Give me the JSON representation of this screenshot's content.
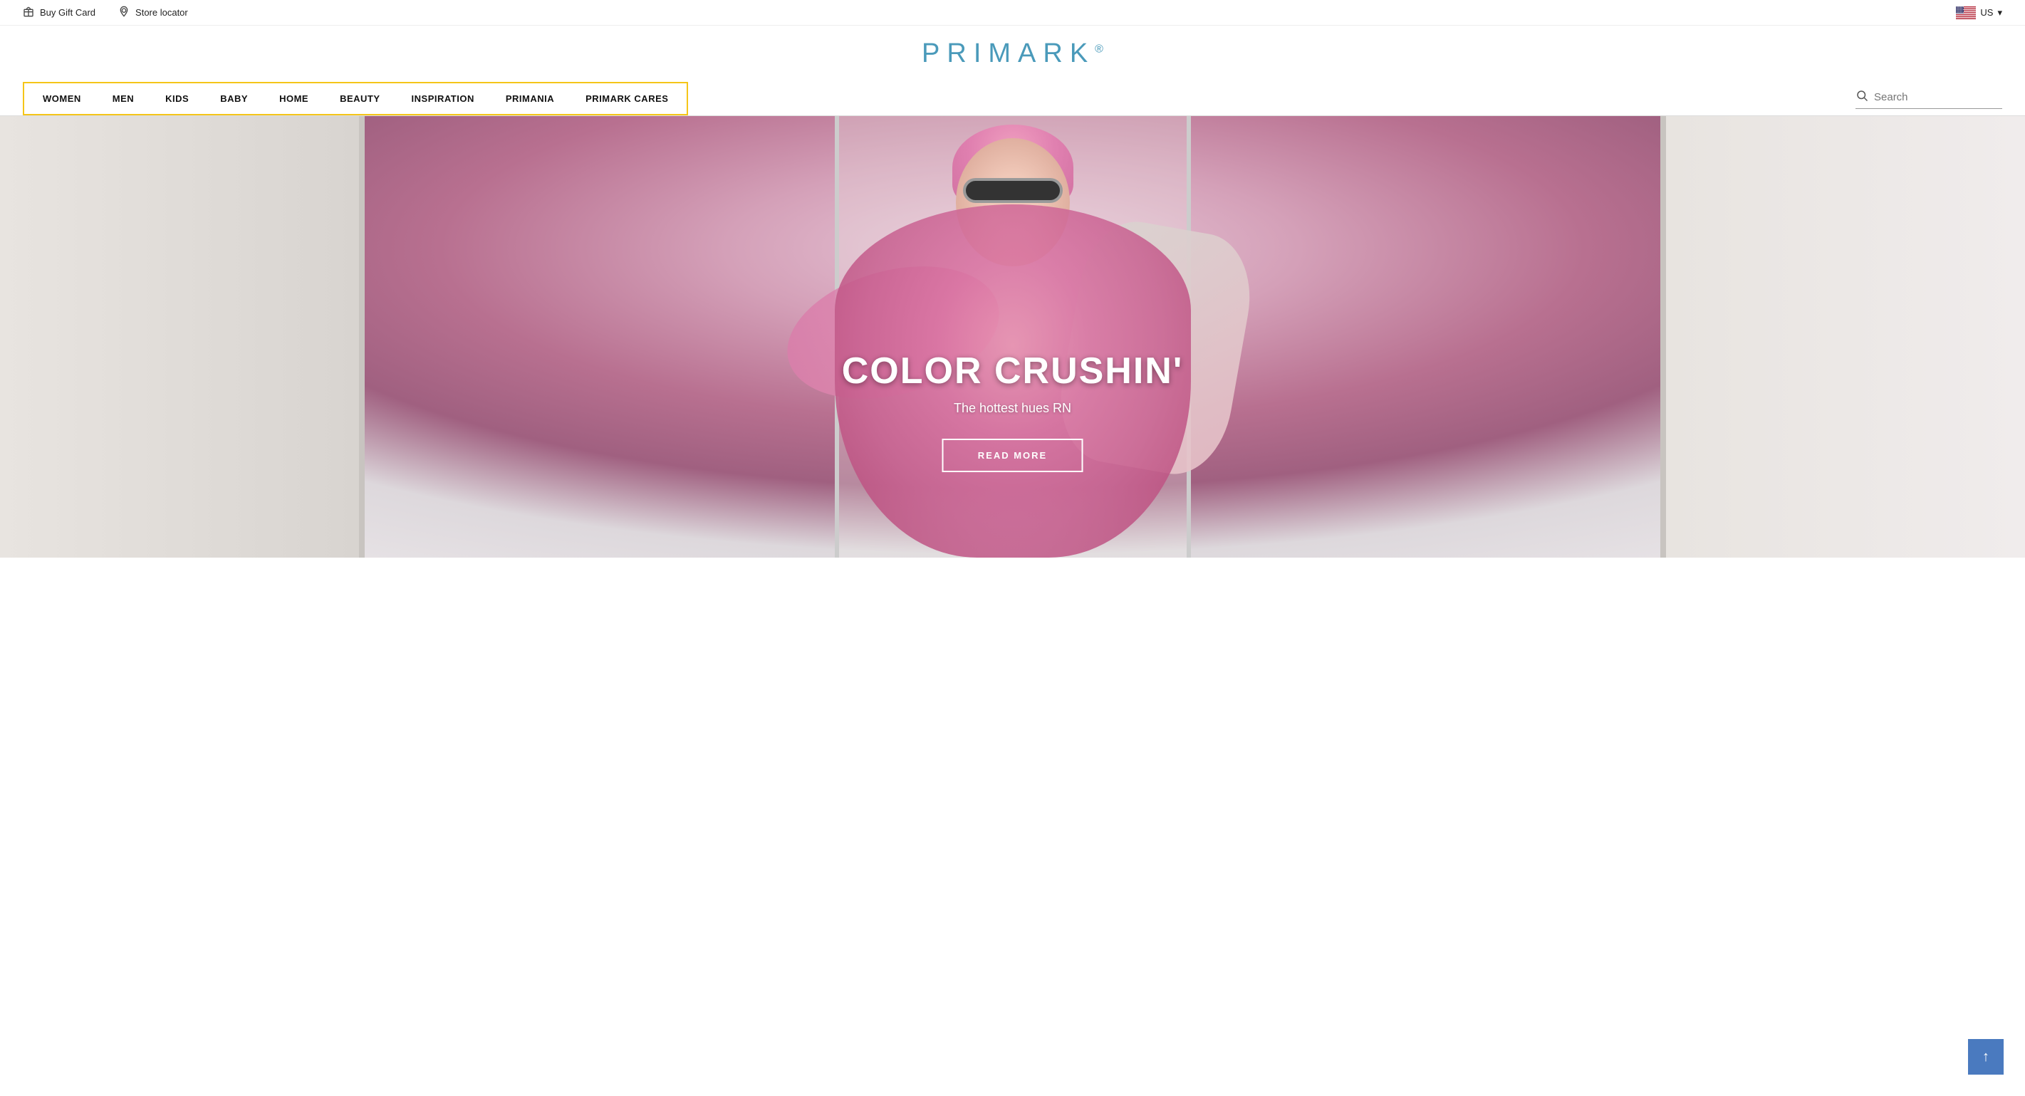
{
  "topBar": {
    "buyGiftCard": "Buy Gift Card",
    "storeLocator": "Store locator",
    "country": "US",
    "giftCardIcon": "gift-icon",
    "locationIcon": "location-icon"
  },
  "header": {
    "logo": "PRIMARK",
    "logoSymbol": "®"
  },
  "nav": {
    "items": [
      {
        "label": "WOMEN",
        "id": "women"
      },
      {
        "label": "MEN",
        "id": "men"
      },
      {
        "label": "KIDS",
        "id": "kids"
      },
      {
        "label": "BABY",
        "id": "baby"
      },
      {
        "label": "HOME",
        "id": "home"
      },
      {
        "label": "BEAUTY",
        "id": "beauty"
      },
      {
        "label": "INSPIRATION",
        "id": "inspiration"
      },
      {
        "label": "PRIMANIA",
        "id": "primania"
      },
      {
        "label": "PRIMARK CARES",
        "id": "primark-cares"
      }
    ],
    "searchPlaceholder": "Search"
  },
  "hero": {
    "title": "COLOR CRUSHIN'",
    "subtitle": "The hottest hues RN",
    "ctaLabel": "READ MORE"
  },
  "scrollTop": {
    "label": "↑"
  }
}
